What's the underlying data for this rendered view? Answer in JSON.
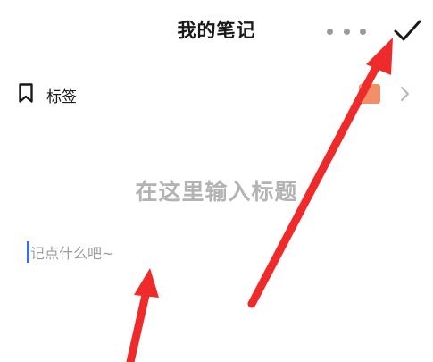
{
  "header": {
    "title": "我的笔记",
    "more_icon": "more-horizontal-icon",
    "confirm_icon": "checkmark-icon"
  },
  "tag_row": {
    "icon": "bookmark-icon",
    "label": "标签",
    "badge_color": "#f07a4e",
    "chevron_icon": "chevron-right-icon"
  },
  "editor": {
    "title_placeholder": "在这里输入标题",
    "body_placeholder": "记点什么吧~",
    "caret_color": "#3b6cf0"
  },
  "annotation": {
    "arrow_color": "#ee2a2a"
  }
}
